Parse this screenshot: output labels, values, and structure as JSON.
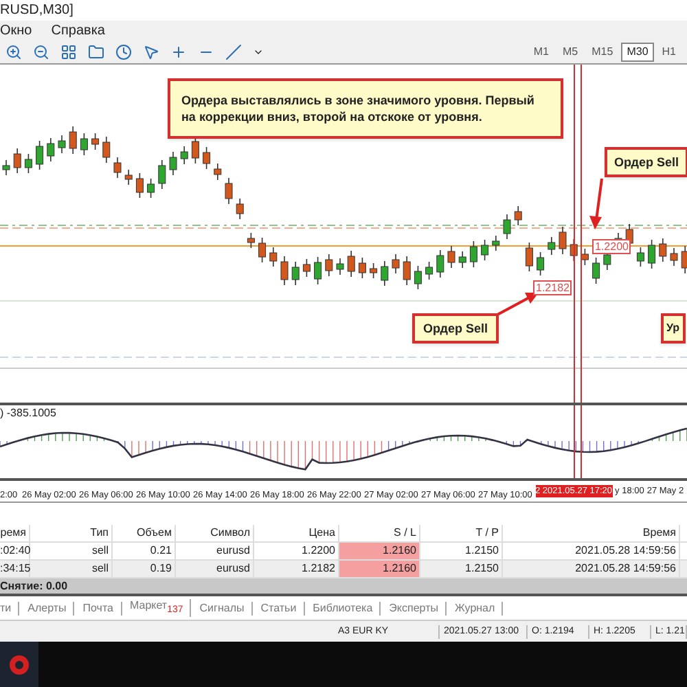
{
  "window": {
    "title": "RUSD,M30]"
  },
  "menu": [
    "Окно",
    "Справка"
  ],
  "timeframes": [
    {
      "label": "M1",
      "selected": false
    },
    {
      "label": "M5",
      "selected": false
    },
    {
      "label": "M15",
      "selected": false
    },
    {
      "label": "M30",
      "selected": true
    },
    {
      "label": "H1",
      "selected": false
    }
  ],
  "chart": {
    "notes": [
      {
        "kind": "main",
        "text": "Ордера выставлялись в зоне значимого уровня. Первый на коррекции вниз, второй на отскоке от уровня."
      },
      {
        "kind": "top",
        "text": "Ордер Sell"
      },
      {
        "kind": "bottom",
        "text": "Ордер Sell"
      },
      {
        "kind": "edge",
        "text": "Ур"
      }
    ],
    "price_tags": [
      "1.2182",
      "1.2200"
    ]
  },
  "indicator": {
    "label": ") -385.1005"
  },
  "time_axis": {
    "labels": [
      "2:00",
      "26 May 02:00",
      "26 May 06:00",
      "26 May 10:00",
      "26 May 14:00",
      "26 May 18:00",
      "26 May 22:00",
      "27 May 02:00",
      "27 May 06:00",
      "27 May 10:00"
    ],
    "cursor": "2 2021.05.27 17:20",
    "after": [
      "y 18:00",
      "27 May 2"
    ]
  },
  "table": {
    "columns": [
      "ремя",
      "Тип",
      "Объем",
      "Символ",
      "Цена",
      "S / L",
      "T / P",
      "Время"
    ],
    "rows": [
      [
        ":02:40",
        "sell",
        "0.21",
        "eurusd",
        "1.2200",
        "1.2160",
        "1.2150",
        "2021.05.28 14:59:56"
      ],
      [
        ":34:15",
        "sell",
        "0.19",
        "eurusd",
        "1.2182",
        "1.2160",
        "1.2150",
        "2021.05.28 14:59:56"
      ]
    ],
    "summary": "Снятие: 0.00"
  },
  "tabs": [
    {
      "label": "ти"
    },
    {
      "label": "Алерты"
    },
    {
      "label": "Почта"
    },
    {
      "label": "Маркет",
      "count": "137"
    },
    {
      "label": "Сигналы"
    },
    {
      "label": "Статьи"
    },
    {
      "label": "Библиотека"
    },
    {
      "label": "Эксперты"
    },
    {
      "label": "Журнал"
    }
  ],
  "status_bar": [
    "A3 EUR KY",
    "2021.05.27 13:00",
    "O: 1.2194",
    "H: 1.2205",
    "L: 1.21"
  ]
}
